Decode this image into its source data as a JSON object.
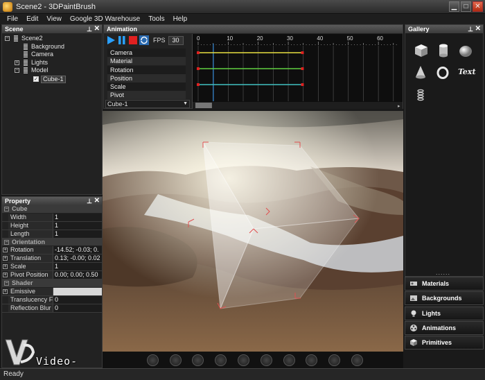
{
  "window": {
    "title": "Scene2 - 3DPaintBrush"
  },
  "menu": [
    "File",
    "Edit",
    "View",
    "Google 3D Warehouse",
    "Tools",
    "Help"
  ],
  "scene_panel": {
    "title": "Scene",
    "nodes": [
      {
        "label": "Scene2",
        "level": 0,
        "expander": "−"
      },
      {
        "label": "Background",
        "level": 1,
        "expander": ""
      },
      {
        "label": "Camera",
        "level": 1,
        "expander": ""
      },
      {
        "label": "Lights",
        "level": 1,
        "expander": "+"
      },
      {
        "label": "Model",
        "level": 1,
        "expander": "−"
      },
      {
        "label": "Cube-1",
        "level": 2,
        "expander": "",
        "selected": true
      }
    ]
  },
  "property_panel": {
    "title": "Property",
    "groups": [
      {
        "name": "Cube",
        "rows": [
          {
            "name": "Width",
            "value": "1"
          },
          {
            "name": "Height",
            "value": "1"
          },
          {
            "name": "Length",
            "value": "1"
          }
        ]
      },
      {
        "name": "Orientation",
        "rows": [
          {
            "name": "Rotation",
            "value": "-14.52; -0.03; 0.",
            "expandable": true
          },
          {
            "name": "Translation",
            "value": "0.13; -0.00; 0.02",
            "expandable": true
          },
          {
            "name": "Scale",
            "value": "1",
            "expandable": true
          },
          {
            "name": "Pivot Position",
            "value": "0.00; 0.00; 0.50",
            "expandable": true
          }
        ]
      },
      {
        "name": "Shader",
        "rows": [
          {
            "name": "Emissive",
            "value": "",
            "expandable": true,
            "white": true
          },
          {
            "name": "Translucency F",
            "value": "0"
          },
          {
            "name": "Reflection Blur",
            "value": "0"
          }
        ]
      }
    ]
  },
  "animation_panel": {
    "title": "Animation",
    "fps_label": "FPS",
    "fps_value": "30",
    "tracks": [
      "Camera",
      "Material",
      "Rotation",
      "Position",
      "Scale",
      "Pivot"
    ],
    "selected_object": "Cube-1",
    "timeline_ticks": [
      "0",
      "10",
      "20",
      "30",
      "40",
      "50",
      "60"
    ],
    "colors": {
      "yellow": "#e8e040",
      "green": "#60d040",
      "cyan": "#40c0c0",
      "key": "#e02020"
    }
  },
  "gallery_panel": {
    "title": "Gallery",
    "items": [
      "cube-icon",
      "cylinder-icon",
      "sphere-icon",
      "cone-icon",
      "torus-icon",
      "text-icon",
      "spring-icon"
    ],
    "text_item_label": "Text",
    "dots": "......",
    "buttons": [
      "Materials",
      "Backgrounds",
      "Lights",
      "Animations",
      "Primitives"
    ]
  },
  "viewport_toolbar": [
    "camera-icon",
    "import-icon",
    "render-icon",
    "undo-icon",
    "redo-icon",
    "select-icon",
    "rotate-icon",
    "pan-icon",
    "zoom-icon",
    "fit-icon"
  ],
  "watermark": "Video-Effects.Ir",
  "status": "Ready"
}
